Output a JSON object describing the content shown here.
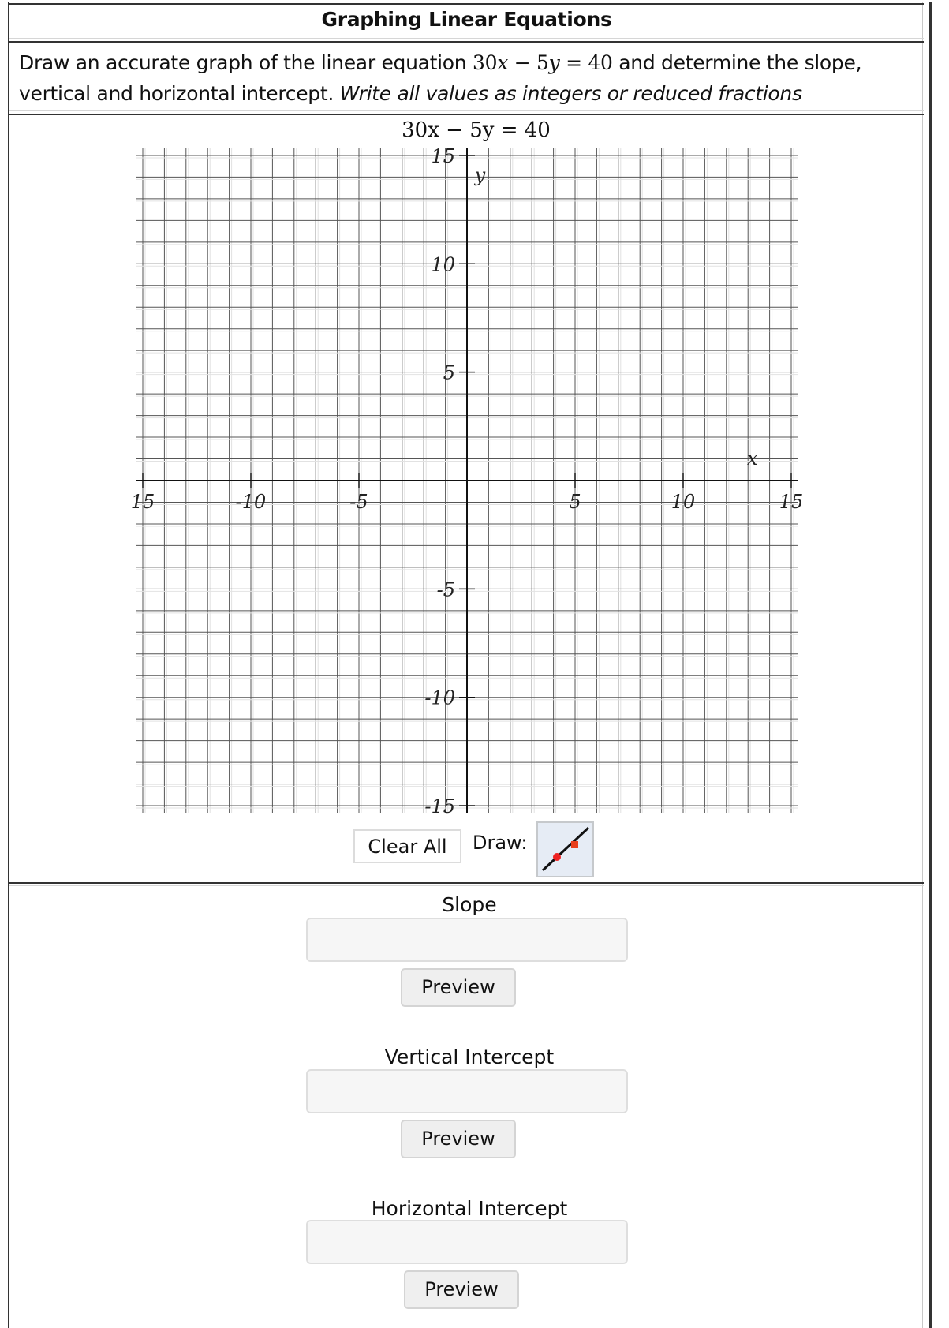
{
  "header": {
    "title": "Graphing Linear Equations"
  },
  "question": {
    "intro": "Draw an accurate graph of the linear equation",
    "equation": {
      "a": "30",
      "x": "x",
      "minus": " − ",
      "b": "5",
      "y": "y",
      "eq": " = ",
      "c": "40"
    },
    "continuation": "and determine the slope, vertical and horizontal intercept.",
    "instruction": "Write all values as integers or reduced fractions"
  },
  "graph": {
    "title": "30x − 5y = 40",
    "x_axis_label": "x",
    "y_axis_label": "y",
    "x_range": [
      -15,
      15
    ],
    "y_range": [
      -15,
      15
    ],
    "grid_step": 1,
    "x_tick_labels": [
      {
        "value": -15,
        "text": "15"
      },
      {
        "value": -10,
        "text": "-10"
      },
      {
        "value": -5,
        "text": "-5"
      },
      {
        "value": 5,
        "text": "5"
      },
      {
        "value": 10,
        "text": "10"
      },
      {
        "value": 15,
        "text": "15"
      }
    ],
    "y_tick_labels": [
      {
        "value": 15,
        "text": "15"
      },
      {
        "value": 10,
        "text": "10"
      },
      {
        "value": 5,
        "text": "5"
      },
      {
        "value": -5,
        "text": "-5"
      },
      {
        "value": -10,
        "text": "-10"
      },
      {
        "value": -15,
        "text": "-15"
      }
    ],
    "grid": true,
    "plotted_lines": []
  },
  "tools": {
    "clear_all_label": "Clear All",
    "draw_label": "Draw:",
    "selected_tool": "line-segment-icon",
    "tool_colors": {
      "background": "#e6ecf5",
      "point": "#ee2222",
      "line": "#111111"
    }
  },
  "answers": [
    {
      "label": "Slope",
      "value": "",
      "preview_label": "Preview"
    },
    {
      "label": "Vertical Intercept",
      "value": "",
      "preview_label": "Preview"
    },
    {
      "label": "Horizontal Intercept",
      "value": "",
      "preview_label": "Preview"
    }
  ]
}
